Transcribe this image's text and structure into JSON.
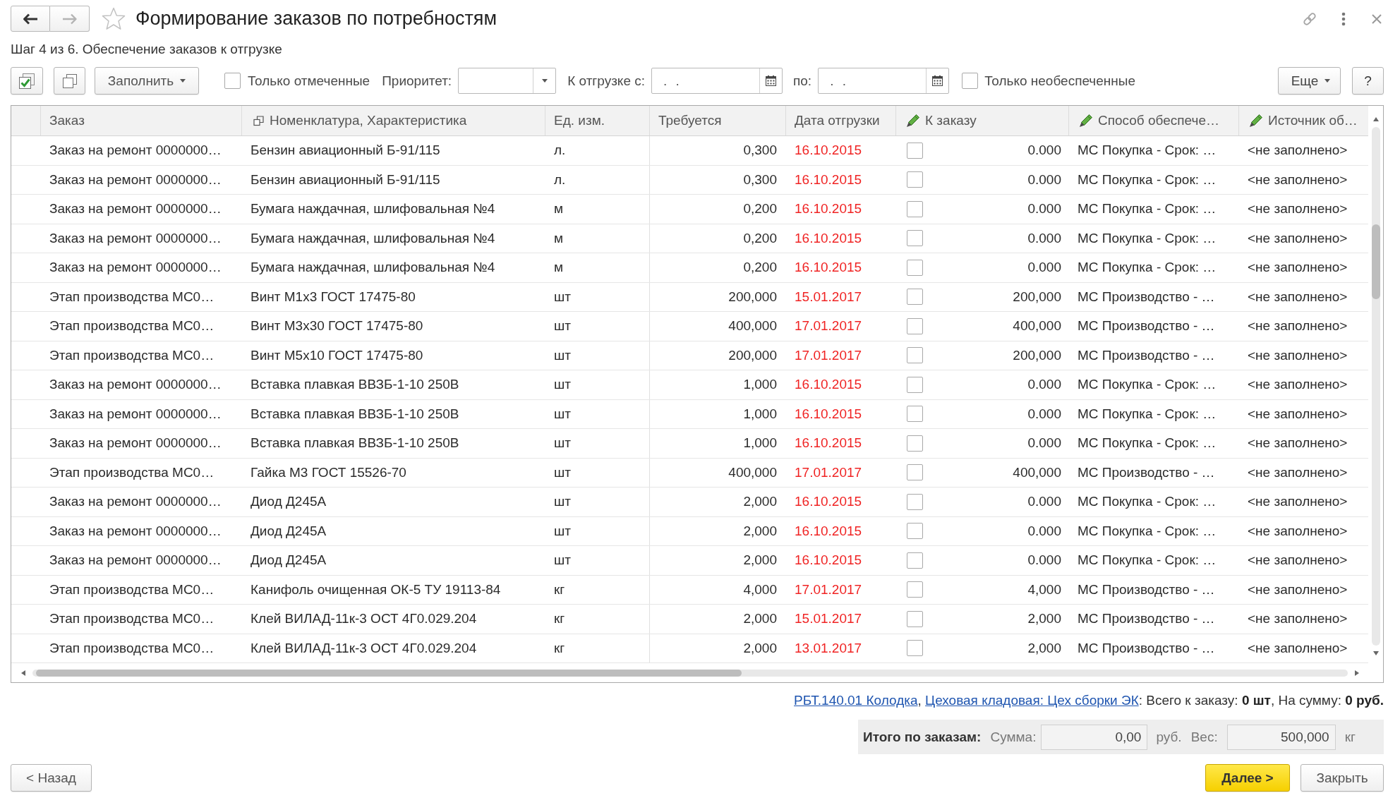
{
  "window": {
    "title": "Формирование заказов по потребностям",
    "favorite": false
  },
  "navigation": [
    {
      "kind": "back",
      "disabled": false
    },
    {
      "kind": "forward",
      "disabled": true
    }
  ],
  "subtitle": "Шаг 4 из 6. Обеспечение заказов к отгрузке",
  "toolbar": {
    "fill_button": "Заполнить",
    "only_marked": {
      "label": "Только отмеченные",
      "checked": false
    },
    "priority_label": "Приоритет:",
    "ship_from": {
      "label": "К отгрузке с:",
      "value": ". ."
    },
    "ship_to": {
      "label": "по:",
      "value": ". ."
    },
    "only_unsecured": {
      "label": "Только необеспеченные",
      "checked": false
    },
    "more_button": "Еще",
    "help_button": "?"
  },
  "table": {
    "columns": [
      {
        "label": "Заказ",
        "kind": "plain"
      },
      {
        "label": "Номенклатура, Характеристика",
        "kind": "linked"
      },
      {
        "label": "Ед. изм.",
        "kind": "plain"
      },
      {
        "label": "Требуется",
        "kind": "plain"
      },
      {
        "label": "Дата отгрузки",
        "kind": "plain"
      },
      {
        "label": "К заказу",
        "kind": "editable"
      },
      {
        "label": "Способ обеспече…",
        "kind": "editable"
      },
      {
        "label": "Источник об…",
        "kind": "editable"
      }
    ],
    "rows": [
      {
        "order": "Заказ на ремонт 0000000…",
        "item": "Бензин авиационный Б-91/115",
        "unit": "л.",
        "required": "0,300",
        "ship_date": "16.10.2015",
        "overdue": true,
        "checked": false,
        "to_order": "0.000",
        "method": "МС Покупка - Срок: …",
        "source": "<не заполнено>",
        "selected": false
      },
      {
        "order": "Заказ на ремонт 0000000…",
        "item": "Бензин авиационный Б-91/115",
        "unit": "л.",
        "required": "0,300",
        "ship_date": "16.10.2015",
        "overdue": true,
        "checked": false,
        "to_order": "0.000",
        "method": "МС Покупка - Срок: …",
        "source": "<не заполнено>",
        "selected": false
      },
      {
        "order": "Заказ на ремонт 0000000…",
        "item": "Бумага наждачная, шлифовальная №4",
        "unit": "м",
        "required": "0,200",
        "ship_date": "16.10.2015",
        "overdue": true,
        "checked": false,
        "to_order": "0.000",
        "method": "МС Покупка - Срок: …",
        "source": "<не заполнено>",
        "selected": false
      },
      {
        "order": "Заказ на ремонт 0000000…",
        "item": "Бумага наждачная, шлифовальная №4",
        "unit": "м",
        "required": "0,200",
        "ship_date": "16.10.2015",
        "overdue": true,
        "checked": false,
        "to_order": "0.000",
        "method": "МС Покупка - Срок: …",
        "source": "<не заполнено>",
        "selected": false
      },
      {
        "order": "Заказ на ремонт 0000000…",
        "item": "Бумага наждачная, шлифовальная №4",
        "unit": "м",
        "required": "0,200",
        "ship_date": "16.10.2015",
        "overdue": true,
        "checked": false,
        "to_order": "0.000",
        "method": "МС Покупка - Срок: …",
        "source": "<не заполнено>",
        "selected": false
      },
      {
        "order": "Этап производства МС0…",
        "item": "Винт М1х3 ГОСТ 17475-80",
        "unit": "шт",
        "required": "200,000",
        "ship_date": "15.01.2017",
        "overdue": true,
        "checked": false,
        "to_order": "200,000",
        "method": "МС Производство - …",
        "source": "<не заполнено>",
        "selected": false
      },
      {
        "order": "Этап производства МС0…",
        "item": "Винт М3х30 ГОСТ 17475-80",
        "unit": "шт",
        "required": "400,000",
        "ship_date": "17.01.2017",
        "overdue": true,
        "checked": false,
        "to_order": "400,000",
        "method": "МС Производство - …",
        "source": "<не заполнено>",
        "selected": false
      },
      {
        "order": "Этап производства МС0…",
        "item": "Винт М5х10 ГОСТ 17475-80",
        "unit": "шт",
        "required": "200,000",
        "ship_date": "17.01.2017",
        "overdue": true,
        "checked": false,
        "to_order": "200,000",
        "method": "МС Производство - …",
        "source": "<не заполнено>",
        "selected": false
      },
      {
        "order": "Заказ на ремонт 0000000…",
        "item": "Вставка плавкая ВВЗБ-1-10 250В",
        "unit": "шт",
        "required": "1,000",
        "ship_date": "16.10.2015",
        "overdue": true,
        "checked": false,
        "to_order": "0.000",
        "method": "МС Покупка - Срок: …",
        "source": "<не заполнено>",
        "selected": false
      },
      {
        "order": "Заказ на ремонт 0000000…",
        "item": "Вставка плавкая ВВЗБ-1-10 250В",
        "unit": "шт",
        "required": "1,000",
        "ship_date": "16.10.2015",
        "overdue": true,
        "checked": false,
        "to_order": "0.000",
        "method": "МС Покупка - Срок: …",
        "source": "<не заполнено>",
        "selected": false
      },
      {
        "order": "Заказ на ремонт 0000000…",
        "item": "Вставка плавкая ВВЗБ-1-10 250В",
        "unit": "шт",
        "required": "1,000",
        "ship_date": "16.10.2015",
        "overdue": true,
        "checked": false,
        "to_order": "0.000",
        "method": "МС Покупка - Срок: …",
        "source": "<не заполнено>",
        "selected": false
      },
      {
        "order": "Этап производства МС0…",
        "item": "Гайка М3 ГОСТ 15526-70",
        "unit": "шт",
        "required": "400,000",
        "ship_date": "17.01.2017",
        "overdue": true,
        "checked": false,
        "to_order": "400,000",
        "method": "МС Производство - …",
        "source": "<не заполнено>",
        "selected": false
      },
      {
        "order": "Заказ на ремонт 0000000…",
        "item": "Диод Д245А",
        "unit": "шт",
        "required": "2,000",
        "ship_date": "16.10.2015",
        "overdue": true,
        "checked": false,
        "to_order": "0.000",
        "method": "МС Покупка - Срок: …",
        "source": "<не заполнено>",
        "selected": false
      },
      {
        "order": "Заказ на ремонт 0000000…",
        "item": "Диод Д245А",
        "unit": "шт",
        "required": "2,000",
        "ship_date": "16.10.2015",
        "overdue": true,
        "checked": false,
        "to_order": "0.000",
        "method": "МС Покупка - Срок: …",
        "source": "<не заполнено>",
        "selected": false
      },
      {
        "order": "Заказ на ремонт 0000000…",
        "item": "Диод Д245А",
        "unit": "шт",
        "required": "2,000",
        "ship_date": "16.10.2015",
        "overdue": true,
        "checked": false,
        "to_order": "0.000",
        "method": "МС Покупка - Срок: …",
        "source": "<не заполнено>",
        "selected": false
      },
      {
        "order": "Этап производства МС0…",
        "item": "Канифоль очищенная ОК-5 ТУ 19113-84",
        "unit": "кг",
        "required": "4,000",
        "ship_date": "17.01.2017",
        "overdue": true,
        "checked": false,
        "to_order": "4,000",
        "method": "МС Производство - …",
        "source": "<не заполнено>",
        "selected": false
      },
      {
        "order": "Этап производства МС0…",
        "item": "Клей ВИЛАД-11к-3 ОСТ 4Г0.029.204",
        "unit": "кг",
        "required": "2,000",
        "ship_date": "15.01.2017",
        "overdue": true,
        "checked": false,
        "to_order": "2,000",
        "method": "МС Производство - …",
        "source": "<не заполнено>",
        "selected": false
      },
      {
        "order": "Этап производства МС0…",
        "item": "Клей ВИЛАД-11к-3 ОСТ 4Г0.029.204",
        "unit": "кг",
        "required": "2,000",
        "ship_date": "13.01.2017",
        "overdue": true,
        "checked": false,
        "to_order": "2,000",
        "method": "МС Производство - …",
        "source": "<не заполнено>",
        "selected": false
      }
    ]
  },
  "summary": [
    {
      "kind": "link",
      "text": "РБТ.140.01 Колодка"
    },
    {
      "kind": "text",
      "text": ", "
    },
    {
      "kind": "link",
      "text": "Цеховая кладовая: Цех сборки ЭК"
    },
    {
      "kind": "text",
      "text": ": Всего к заказу: **0 шт**, На сумму: **0 руб.**"
    }
  ],
  "totals": {
    "label": "Итого по заказам:",
    "sum_label": "Сумма:",
    "sum": "0,00",
    "sum_unit": "руб.",
    "weight_label": "Вес:",
    "weight": "500,000",
    "weight_unit": "кг"
  },
  "buttons": [
    {
      "label": "< Назад",
      "kind": "back"
    },
    {
      "label": "Далее >",
      "kind": "primary"
    },
    {
      "label": "Закрыть",
      "kind": "normal"
    }
  ]
}
